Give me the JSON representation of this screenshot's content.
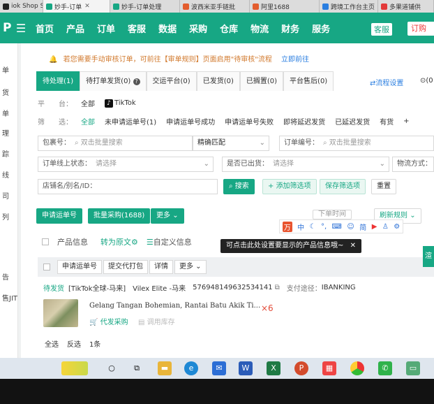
{
  "browser_tabs": [
    {
      "label": "iok Shop Se",
      "color": "#222222"
    },
    {
      "label": "妙手-订单",
      "color": "#17a784",
      "active": true
    },
    {
      "label": "妙手-订单处理",
      "color": "#17a784"
    },
    {
      "label": "波西米亚手链批",
      "color": "#e35d2e"
    },
    {
      "label": "阿里1688",
      "color": "#e35d2e"
    },
    {
      "label": "跨境工作台主页",
      "color": "#2a7ee0"
    },
    {
      "label": "多果道铺供",
      "color": "#e33a3a"
    }
  ],
  "nav": {
    "logo": "P",
    "items": [
      "首页",
      "产品",
      "订单",
      "客服",
      "数据",
      "采购",
      "仓库",
      "物流",
      "财务",
      "服务"
    ],
    "kefu": "客服",
    "order_btn": "订购"
  },
  "left_nav": [
    "单",
    "货",
    "单",
    "理",
    "踪",
    "线",
    "司",
    "列",
    "告",
    "售JIT"
  ],
  "notice": {
    "text": "若您需要手动审核订单，可前往【审单规则】页面启用\"待审核\"流程",
    "link": "立即前往"
  },
  "order_tabs": [
    "待处理(1)",
    "待打单发货(0)",
    "交运平台(0)",
    "已发货(0)",
    "已搁置(0)",
    "平台售后(0)"
  ],
  "flow_settings": "流程设置",
  "flow_extra": "(0",
  "platform_filter": {
    "label": "平　　台：",
    "all": "全部",
    "tiktok": "TikTok"
  },
  "status_filter": {
    "label": "筛　　选：",
    "options": [
      "全部",
      "未申请运单号(1)",
      "申请运单号成功",
      "申请运单号失败",
      "即将延迟发货",
      "已延迟发货",
      "有货",
      "+"
    ]
  },
  "search": {
    "package_label": "包裹号：",
    "package_placeholder": "双击批量搜索",
    "match": "精确匹配",
    "order_label": "订单编号：",
    "order_placeholder": "双击批量搜索",
    "online_status_label": "订单线上状态：",
    "online_status_placeholder": "请选择",
    "out_label": "是否已出货：",
    "out_placeholder": "请选择",
    "logistics_label": "物流方式：",
    "shop_label": "店铺名/别名/ID：",
    "search_btn": "搜索",
    "add_filter_btn": "添加筛选项",
    "save_filter_btn": "保存筛选项",
    "reset_btn": "重置"
  },
  "actions": {
    "apply_waybill": "申请运单号",
    "bulk_purchase": "批量采购(1688)",
    "more": "更多",
    "order_time": "下单时间",
    "refresh_rule": "刷新规则"
  },
  "toolbar_icons": [
    "万",
    "中",
    "月",
    "图",
    "简",
    "衣",
    "设"
  ],
  "product_header": {
    "info": "产品信息",
    "to_original": "转为原文",
    "custom_info": "自定义信息",
    "tooltip": "可点击此处设置要显示的产品信息哦~"
  },
  "row_actions": [
    "申请运单号",
    "提交代打包",
    "详情",
    "更多"
  ],
  "order": {
    "status": "待发货",
    "shop": "[TikTok全球-马来]",
    "store": "Vilex Elite -马来",
    "order_no": "576948149632534141",
    "pay_label": "支付途径：",
    "pay_value": "IBANKING"
  },
  "product": {
    "name": "Gelang Tangan Bohemian, Rantai Batu Akik Ti...",
    "qty": "×6",
    "purchase": "代发采购",
    "stock": "调用库存"
  },
  "bottom": {
    "select_all": "全选",
    "invert": "反选",
    "count": "1条"
  },
  "side_pin": "渲"
}
